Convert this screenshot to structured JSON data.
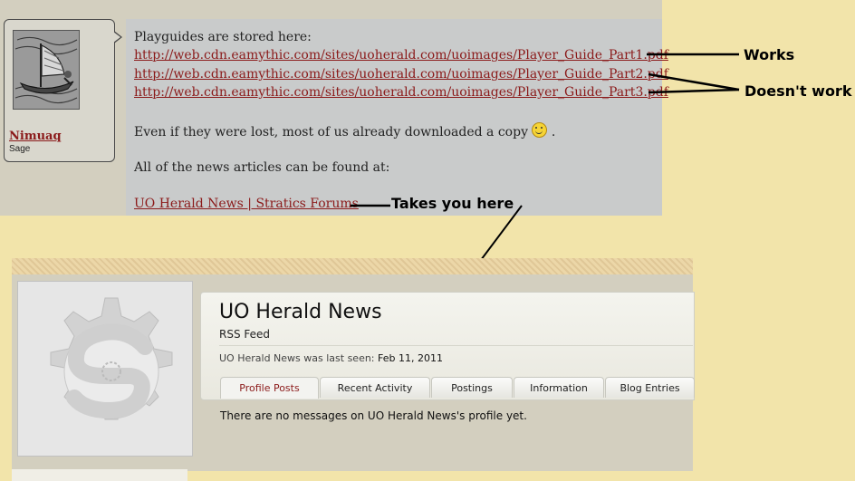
{
  "post": {
    "username": "Nimuaq",
    "user_title": "Sage",
    "intro": "Playguides are stored here:",
    "links": [
      "http://web.cdn.eamythic.com/sites/uoherald.com/uoimages/Player_Guide_Part1.pdf",
      "http://web.cdn.eamythic.com/sites/uoherald.com/uoimages/Player_Guide_Part2.pdf",
      "http://web.cdn.eamythic.com/sites/uoherald.com/uoimages/Player_Guide_Part3.pdf"
    ],
    "lost_text": "Even if they were lost, most of us already downloaded a copy",
    "lost_suffix": ".",
    "news_text": "All of the news articles can be found at:",
    "news_link": "UO Herald News | Stratics Forums",
    "smiley_icon": "smile-icon"
  },
  "annotations": {
    "works": "Works",
    "doesnt_work": "Doesn't work",
    "takes_you_here": "Takes you here"
  },
  "profile": {
    "name": "UO Herald News",
    "subtitle": "RSS Feed",
    "last_seen_label": "UO Herald News was last seen:",
    "last_seen_value": "Feb 11, 2011",
    "tabs": [
      "Profile Posts",
      "Recent Activity",
      "Postings",
      "Information",
      "Blog Entries"
    ],
    "active_tab": "Profile Posts",
    "empty_message": "There are no messages on UO Herald News's profile yet.",
    "avatar_icon": "stratics-gear-logo-icon"
  },
  "colors": {
    "page_bg": "#f2e4aa",
    "panel_bg": "#d3cfbf",
    "message_bg": "#c9cbcb",
    "link": "#8b1a1a"
  }
}
